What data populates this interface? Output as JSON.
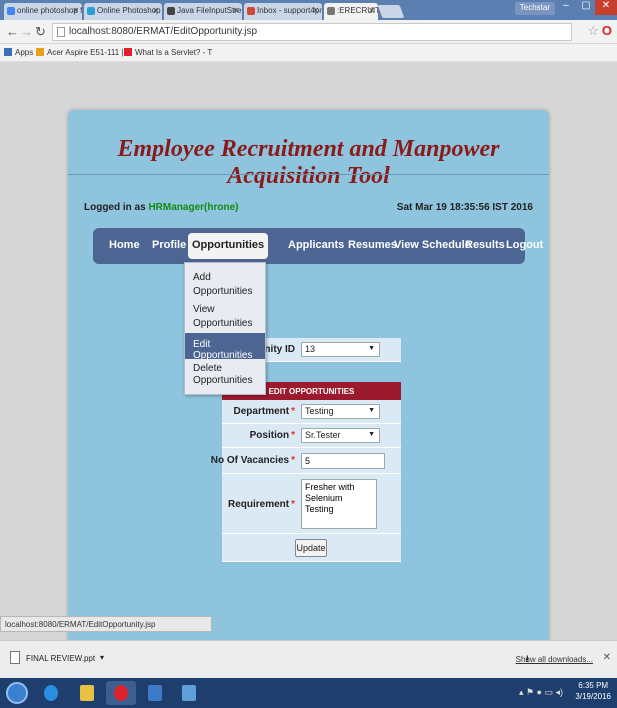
{
  "browser": {
    "tabs": [
      {
        "label": "online photoshop free - ",
        "icon_color": "#4285f4"
      },
      {
        "label": "Online Photoshop Free - ",
        "icon_color": "#2a9fd6"
      },
      {
        "label": "Java FileInputStream and",
        "icon_color": "#444444"
      },
      {
        "label": "Inbox - support4project",
        "icon_color": "#d14836"
      },
      {
        "label": ":ERECRUITMENT:",
        "icon_color": "#777777",
        "active": true
      }
    ],
    "user_badge": "Techstar",
    "url": "localhost:8080/ERMAT/EditOpportunity.jsp",
    "bookmarks": [
      {
        "label": "Apps",
        "icon_color": "#3b6fb6"
      },
      {
        "label": "Acer Aspire E51-111 |",
        "icon_color": "#e8a21a"
      },
      {
        "label": "What Is a Servlet? - T",
        "icon_color": "#e0202a"
      }
    ]
  },
  "app": {
    "title": "Employee Recruitment and Manpower Acquisition Tool",
    "logged_in_prefix": "Logged in as",
    "logged_in_user": "HRManager(hrone)",
    "datetime": "Sat Mar 19 18:35:56 IST 2016",
    "menu": [
      {
        "label": "Home"
      },
      {
        "label": "Profile"
      },
      {
        "label": "Opportunities",
        "active": true
      },
      {
        "label": "Applicants"
      },
      {
        "label": "Resumes"
      },
      {
        "label": "View Schedule"
      },
      {
        "label": "Results"
      },
      {
        "label": "Logout"
      }
    ],
    "dropdown": [
      {
        "label": "Add Opportunities"
      },
      {
        "label": "View Opportunities"
      },
      {
        "label": "Edit Opportunities",
        "selected": true
      },
      {
        "label": "Delete Opportunities"
      }
    ]
  },
  "form": {
    "opportunity_id_label": "unity ID",
    "opportunity_id_value": "13",
    "section_header": "EDIT OPPORTUNITIES",
    "department_label": "Department",
    "department_value": "Testing",
    "position_label": "Position",
    "position_value": "Sr.Tester",
    "vacancies_label": "No Of Vacancies",
    "vacancies_value": "5",
    "requirement_label": "Requirement",
    "requirement_value": "Fresher with Selenium Testing",
    "required_mark": "*",
    "update_button": "Update"
  },
  "status_url": "localhost:8080/ERMAT/EditOpportunity.jsp",
  "downloads": {
    "file": "FINAL REVIEW.ppt",
    "show_all": "Show all downloads..."
  },
  "taskbar": {
    "time": "6:35 PM",
    "date": "3/19/2016"
  },
  "colors": {
    "panel": "#8ec4dd",
    "title": "#8b1a1a",
    "menubar": "#4c6592",
    "edit_header": "#9b1a2e",
    "user_green": "#138a13"
  }
}
